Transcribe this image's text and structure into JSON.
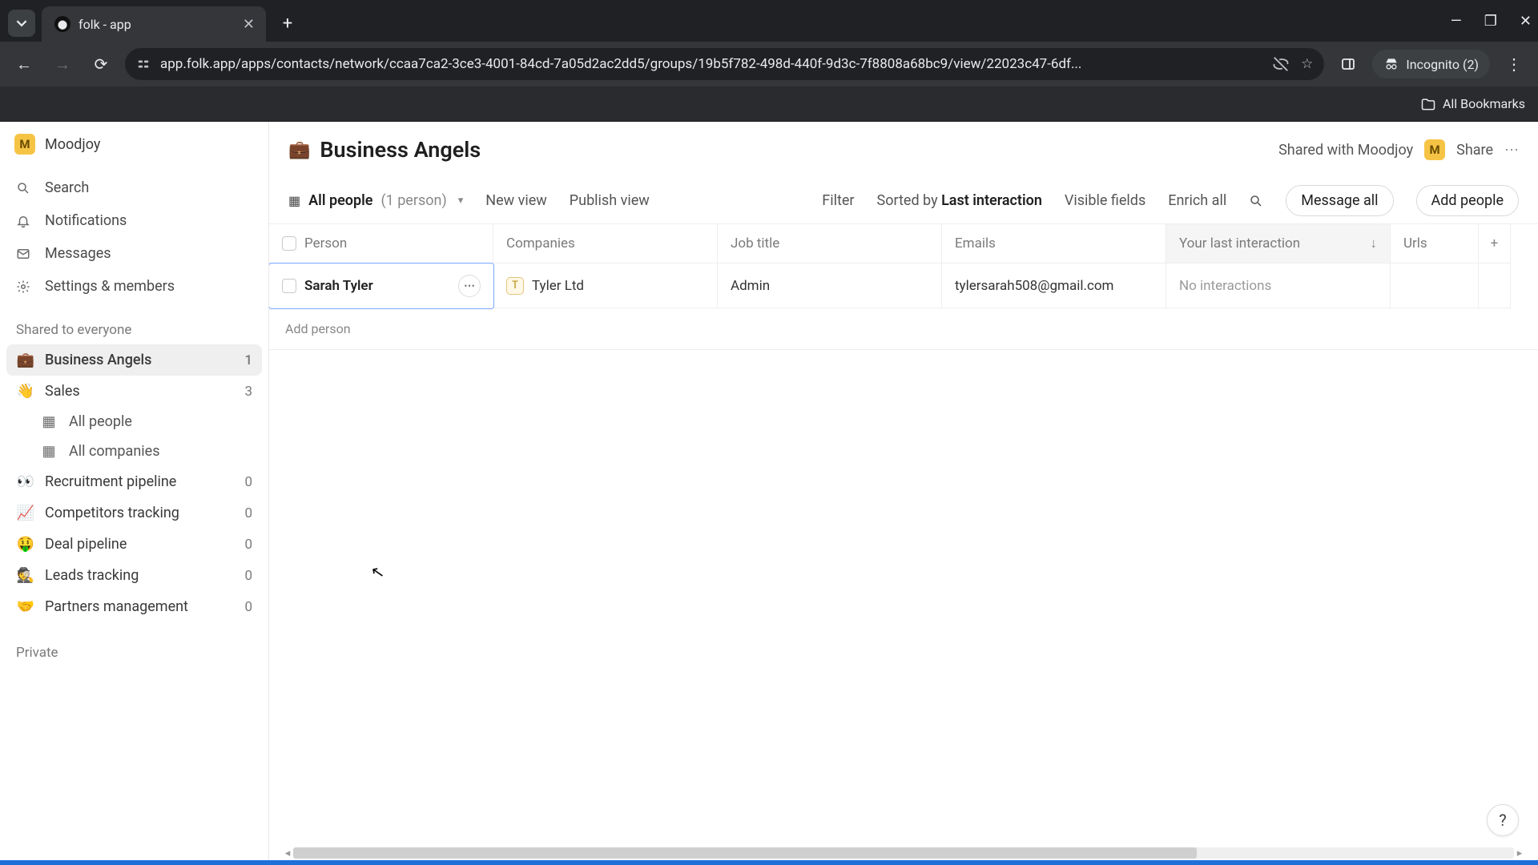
{
  "browser": {
    "tab_title": "folk - app",
    "url": "app.folk.app/apps/contacts/network/ccaa7ca2-3ce3-4001-84cd-7a05d2ac2dd5/groups/19b5f782-498d-440f-9d3c-7f8808a68bc9/view/22023c47-6df...",
    "incognito_label": "Incognito (2)",
    "all_bookmarks": "All Bookmarks"
  },
  "workspace": {
    "name": "Moodjoy",
    "initial": "M"
  },
  "nav": {
    "search": "Search",
    "notifications": "Notifications",
    "messages": "Messages",
    "settings": "Settings & members"
  },
  "sections": {
    "shared": "Shared to everyone",
    "private": "Private"
  },
  "groups": [
    {
      "emoji": "💼",
      "name": "Business Angels",
      "count": "1",
      "active": true
    },
    {
      "emoji": "👋",
      "name": "Sales",
      "count": "3",
      "children": [
        {
          "icon": "▦",
          "name": "All people"
        },
        {
          "icon": "▦",
          "name": "All companies"
        }
      ]
    },
    {
      "emoji": "👀",
      "name": "Recruitment pipeline",
      "count": "0"
    },
    {
      "emoji": "📈",
      "name": "Competitors tracking",
      "count": "0"
    },
    {
      "emoji": "🤑",
      "name": "Deal pipeline",
      "count": "0"
    },
    {
      "emoji": "🕵️",
      "name": "Leads tracking",
      "count": "0"
    },
    {
      "emoji": "🤝",
      "name": "Partners management",
      "count": "0"
    }
  ],
  "page": {
    "emoji": "💼",
    "title": "Business Angels",
    "shared_with": "Shared with Moodjoy",
    "share_label": "Share"
  },
  "toolbar": {
    "view_name": "All people",
    "view_count": "(1 person)",
    "new_view": "New view",
    "publish_view": "Publish view",
    "filter": "Filter",
    "sorted_by_prefix": "Sorted by ",
    "sorted_by_field": "Last interaction",
    "visible_fields": "Visible fields",
    "enrich_all": "Enrich all",
    "message_all": "Message all",
    "add_people": "Add people"
  },
  "columns": {
    "person": "Person",
    "companies": "Companies",
    "job_title": "Job title",
    "emails": "Emails",
    "last_interaction": "Your last interaction",
    "urls": "Urls"
  },
  "rows": [
    {
      "person": "Sarah Tyler",
      "company_initial": "T",
      "company": "Tyler Ltd",
      "job_title": "Admin",
      "email": "tylersarah508@gmail.com",
      "last_interaction": "No interactions",
      "urls": ""
    }
  ],
  "add_person": "Add person"
}
